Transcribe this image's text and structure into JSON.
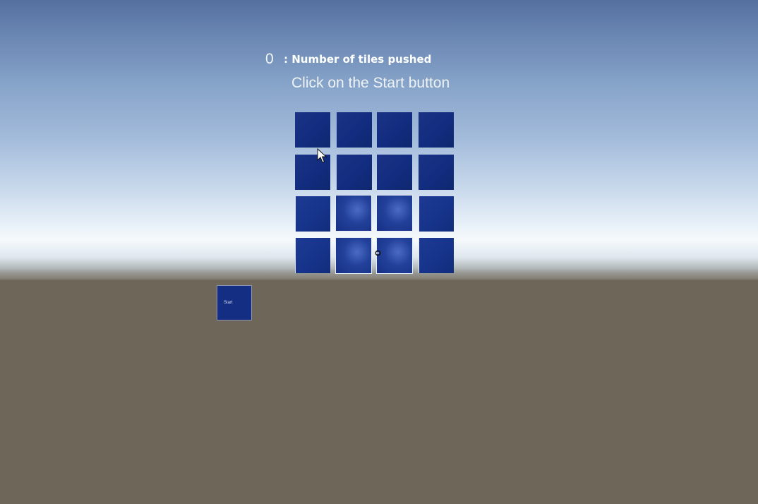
{
  "hud": {
    "tiles_pushed_count": "0",
    "tiles_pushed_label": ": Number of tiles pushed",
    "instruction": "Click on the Start button"
  },
  "controls": {
    "start_label": "Start"
  },
  "tile_grid": {
    "rows": 4,
    "columns": 4,
    "tile_color": "#122c7f"
  },
  "colors": {
    "sky_top": "#55709f",
    "horizon": "#f6f9fc",
    "ground": "#6f665a",
    "tile": "#122c7f",
    "text": "#ffffff"
  },
  "icons": {
    "pointer": "cursor-icon",
    "reticle": "crosshair-icon"
  }
}
